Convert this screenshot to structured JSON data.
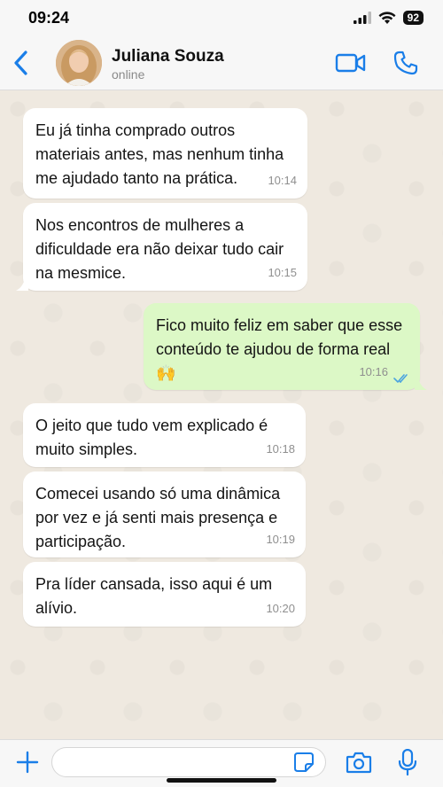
{
  "status_bar": {
    "time": "09:24",
    "battery": "92",
    "icons": [
      "signal-icon",
      "wifi-icon",
      "battery-icon"
    ]
  },
  "header": {
    "contact_name": "Juliana Souza",
    "contact_status": "online",
    "icons": [
      "back-chevron-icon",
      "video-call-icon",
      "phone-icon"
    ],
    "accent_color": "#1a7ee8"
  },
  "messages": [
    {
      "direction": "in",
      "text": "Eu já tinha comprado outros materiais antes, mas nenhum tinha me ajudado tanto na prática.",
      "time": "10:14"
    },
    {
      "direction": "in",
      "text": "Nos encontros de mulheres a dificuldade era não deixar tudo cair na mesmice.",
      "time": "10:15"
    },
    {
      "direction": "out",
      "text": "Fico muito feliz em saber que esse conteúdo te ajudou de forma real 🙌",
      "time": "10:16",
      "status": "read"
    },
    {
      "direction": "in",
      "text": "O jeito que tudo vem explicado é muito simples.",
      "time": "10:18"
    },
    {
      "direction": "in",
      "text": "Comecei usando só uma dinâmica por vez e já senti mais presença e participação.",
      "time": "10:19"
    },
    {
      "direction": "in",
      "text": "Pra líder cansada, isso aqui é um alívio.",
      "time": "10:20"
    }
  ],
  "colors": {
    "chat_background": "#efe9e0",
    "incoming_bubble": "#ffffff",
    "outgoing_bubble": "#dcf8c6",
    "read_ticks": "#4aa3df"
  },
  "input_bar": {
    "value": "",
    "placeholder": "",
    "icons": [
      "plus-icon",
      "sticker-icon",
      "camera-icon",
      "microphone-icon"
    ]
  }
}
